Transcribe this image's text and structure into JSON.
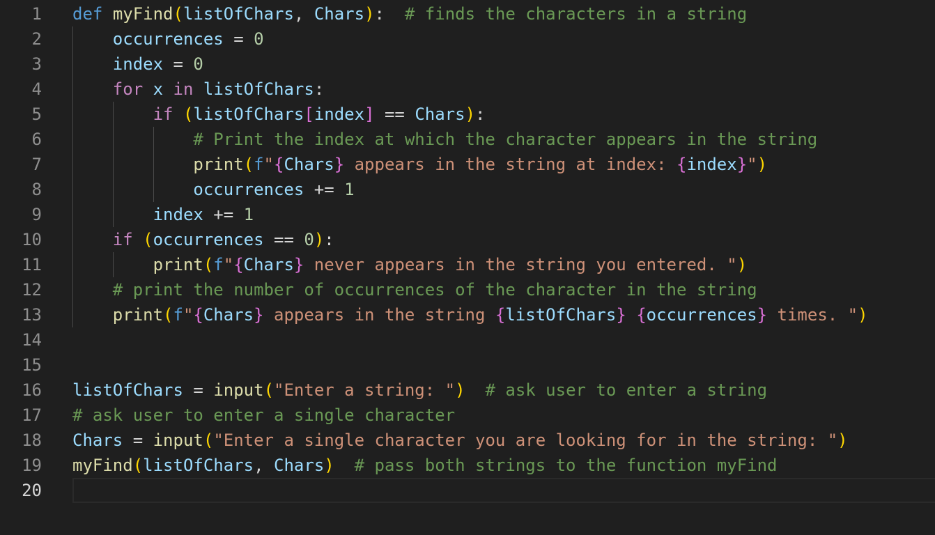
{
  "editor": {
    "line_numbers": [
      "1",
      "2",
      "3",
      "4",
      "5",
      "6",
      "7",
      "8",
      "9",
      "10",
      "11",
      "12",
      "13",
      "14",
      "15",
      "16",
      "17",
      "18",
      "19",
      "20"
    ],
    "current_line": "20",
    "lines": [
      [
        {
          "t": "def",
          "c": "kw"
        },
        {
          "t": " "
        },
        {
          "t": "myFind",
          "c": "fn"
        },
        {
          "t": "(",
          "c": "p1"
        },
        {
          "t": "listOfChars",
          "c": "var"
        },
        {
          "t": ", "
        },
        {
          "t": "Chars",
          "c": "var"
        },
        {
          "t": ")",
          "c": "p1"
        },
        {
          "t": ":  "
        },
        {
          "t": "# finds the characters in a string",
          "c": "cm"
        }
      ],
      [
        {
          "t": "    "
        },
        {
          "t": "occurrences",
          "c": "var"
        },
        {
          "t": " = "
        },
        {
          "t": "0",
          "c": "num"
        }
      ],
      [
        {
          "t": "    "
        },
        {
          "t": "index",
          "c": "var"
        },
        {
          "t": " = "
        },
        {
          "t": "0",
          "c": "num"
        }
      ],
      [
        {
          "t": "    "
        },
        {
          "t": "for",
          "c": "ctl"
        },
        {
          "t": " "
        },
        {
          "t": "x",
          "c": "var"
        },
        {
          "t": " "
        },
        {
          "t": "in",
          "c": "ctl"
        },
        {
          "t": " "
        },
        {
          "t": "listOfChars",
          "c": "var"
        },
        {
          "t": ":"
        }
      ],
      [
        {
          "t": "        "
        },
        {
          "t": "if",
          "c": "ctl"
        },
        {
          "t": " "
        },
        {
          "t": "(",
          "c": "p1"
        },
        {
          "t": "listOfChars",
          "c": "var"
        },
        {
          "t": "[",
          "c": "p2"
        },
        {
          "t": "index",
          "c": "var"
        },
        {
          "t": "]",
          "c": "p2"
        },
        {
          "t": " == "
        },
        {
          "t": "Chars",
          "c": "var"
        },
        {
          "t": ")",
          "c": "p1"
        },
        {
          "t": ":"
        }
      ],
      [
        {
          "t": "            "
        },
        {
          "t": "# Print the index at which the character appears in the string",
          "c": "cm"
        }
      ],
      [
        {
          "t": "            "
        },
        {
          "t": "print",
          "c": "fn"
        },
        {
          "t": "(",
          "c": "p1"
        },
        {
          "t": "f",
          "c": "kw"
        },
        {
          "t": "\"",
          "c": "str"
        },
        {
          "t": "{",
          "c": "br"
        },
        {
          "t": "Chars",
          "c": "var"
        },
        {
          "t": "}",
          "c": "br"
        },
        {
          "t": " appears in the string at index: ",
          "c": "str"
        },
        {
          "t": "{",
          "c": "br"
        },
        {
          "t": "index",
          "c": "var"
        },
        {
          "t": "}",
          "c": "br"
        },
        {
          "t": "\"",
          "c": "str"
        },
        {
          "t": ")",
          "c": "p1"
        }
      ],
      [
        {
          "t": "            "
        },
        {
          "t": "occurrences",
          "c": "var"
        },
        {
          "t": " += "
        },
        {
          "t": "1",
          "c": "num"
        }
      ],
      [
        {
          "t": "        "
        },
        {
          "t": "index",
          "c": "var"
        },
        {
          "t": " += "
        },
        {
          "t": "1",
          "c": "num"
        }
      ],
      [
        {
          "t": "    "
        },
        {
          "t": "if",
          "c": "ctl"
        },
        {
          "t": " "
        },
        {
          "t": "(",
          "c": "p1"
        },
        {
          "t": "occurrences",
          "c": "var"
        },
        {
          "t": " == "
        },
        {
          "t": "0",
          "c": "num"
        },
        {
          "t": ")",
          "c": "p1"
        },
        {
          "t": ":"
        }
      ],
      [
        {
          "t": "        "
        },
        {
          "t": "print",
          "c": "fn"
        },
        {
          "t": "(",
          "c": "p1"
        },
        {
          "t": "f",
          "c": "kw"
        },
        {
          "t": "\"",
          "c": "str"
        },
        {
          "t": "{",
          "c": "br"
        },
        {
          "t": "Chars",
          "c": "var"
        },
        {
          "t": "}",
          "c": "br"
        },
        {
          "t": " never appears in the string you entered. ",
          "c": "str"
        },
        {
          "t": "\"",
          "c": "str"
        },
        {
          "t": ")",
          "c": "p1"
        }
      ],
      [
        {
          "t": "    "
        },
        {
          "t": "# print the number of occurrences of the character in the string",
          "c": "cm"
        }
      ],
      [
        {
          "t": "    "
        },
        {
          "t": "print",
          "c": "fn"
        },
        {
          "t": "(",
          "c": "p1"
        },
        {
          "t": "f",
          "c": "kw"
        },
        {
          "t": "\"",
          "c": "str"
        },
        {
          "t": "{",
          "c": "br"
        },
        {
          "t": "Chars",
          "c": "var"
        },
        {
          "t": "}",
          "c": "br"
        },
        {
          "t": " appears in the string ",
          "c": "str"
        },
        {
          "t": "{",
          "c": "br"
        },
        {
          "t": "listOfChars",
          "c": "var"
        },
        {
          "t": "}",
          "c": "br"
        },
        {
          "t": " ",
          "c": "str"
        },
        {
          "t": "{",
          "c": "br"
        },
        {
          "t": "occurrences",
          "c": "var"
        },
        {
          "t": "}",
          "c": "br"
        },
        {
          "t": " times. ",
          "c": "str"
        },
        {
          "t": "\"",
          "c": "str"
        },
        {
          "t": ")",
          "c": "p1"
        }
      ],
      [],
      [],
      [
        {
          "t": "listOfChars",
          "c": "var"
        },
        {
          "t": " = "
        },
        {
          "t": "input",
          "c": "fn"
        },
        {
          "t": "(",
          "c": "p1"
        },
        {
          "t": "\"Enter a string: \"",
          "c": "str"
        },
        {
          "t": ")",
          "c": "p1"
        },
        {
          "t": "  "
        },
        {
          "t": "# ask user to enter a string",
          "c": "cm"
        }
      ],
      [
        {
          "t": "# ask user to enter a single character",
          "c": "cm"
        }
      ],
      [
        {
          "t": "Chars",
          "c": "var"
        },
        {
          "t": " = "
        },
        {
          "t": "input",
          "c": "fn"
        },
        {
          "t": "(",
          "c": "p1"
        },
        {
          "t": "\"Enter a single character you are looking for in the string: \"",
          "c": "str"
        },
        {
          "t": ")",
          "c": "p1"
        }
      ],
      [
        {
          "t": "myFind",
          "c": "fn"
        },
        {
          "t": "(",
          "c": "p1"
        },
        {
          "t": "listOfChars",
          "c": "var"
        },
        {
          "t": ", "
        },
        {
          "t": "Chars",
          "c": "var"
        },
        {
          "t": ")",
          "c": "p1"
        },
        {
          "t": "  "
        },
        {
          "t": "# pass both strings to the function myFind",
          "c": "cm"
        }
      ],
      []
    ]
  }
}
